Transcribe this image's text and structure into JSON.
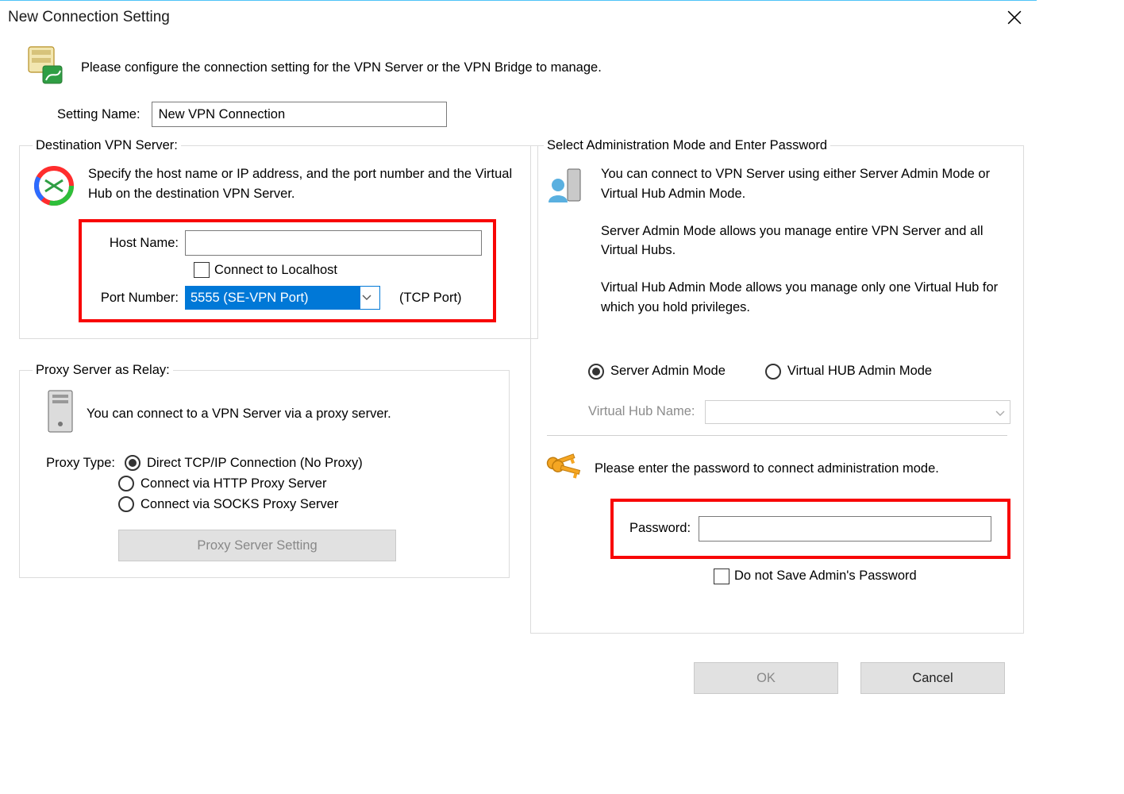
{
  "window": {
    "title": "New Connection Setting"
  },
  "intro": "Please configure the connection setting for the VPN Server or the VPN Bridge to manage.",
  "setting_name": {
    "label": "Setting Name:",
    "value": "New VPN Connection"
  },
  "dest": {
    "legend": "Destination VPN Server:",
    "desc": "Specify the host name or IP address, and the port number and the Virtual Hub on the destination VPN Server.",
    "host_label": "Host Name:",
    "host_value": "",
    "localhost_label": "Connect to Localhost",
    "port_label": "Port Number:",
    "port_value": "5555 (SE-VPN Port)",
    "tcp_label": "(TCP Port)"
  },
  "proxy": {
    "legend": "Proxy Server as Relay:",
    "desc": "You can connect to a VPN Server via a proxy server.",
    "type_label": "Proxy Type:",
    "opt_direct": "Direct TCP/IP Connection (No Proxy)",
    "opt_http": "Connect via HTTP Proxy Server",
    "opt_socks": "Connect via SOCKS Proxy Server",
    "btn_label": "Proxy Server Setting"
  },
  "admin": {
    "legend": "Select Administration Mode and Enter Password",
    "p1": "You can connect to VPN Server using either Server Admin Mode or Virtual Hub Admin Mode.",
    "p2": "Server Admin Mode allows you manage entire VPN Server and all Virtual Hubs.",
    "p3": "Virtual Hub Admin Mode allows you manage only one Virtual Hub for which you hold privileges.",
    "radio_server": "Server Admin Mode",
    "radio_vhub": "Virtual HUB Admin Mode",
    "vhub_label": "Virtual Hub Name:",
    "pwd_prompt": "Please enter the password to connect administration mode.",
    "pwd_label": "Password:",
    "pwd_value": "",
    "save_label": "Do not Save Admin's Password"
  },
  "buttons": {
    "ok": "OK",
    "cancel": "Cancel"
  }
}
